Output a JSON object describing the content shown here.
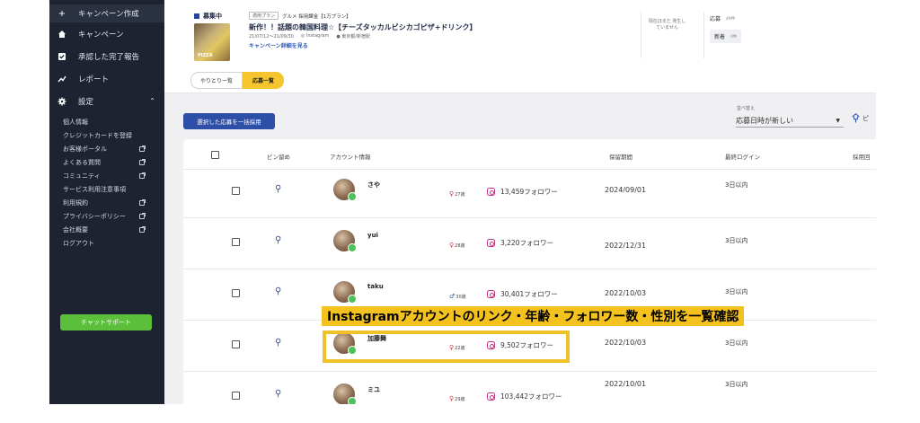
{
  "sidebar": {
    "create_campaign": "キャンペーン作成",
    "items": [
      {
        "label": "キャンペーン",
        "icon": "home-icon"
      },
      {
        "label": "承認した完了報告",
        "icon": "checkbox-icon"
      },
      {
        "label": "レポート",
        "icon": "chart-icon"
      },
      {
        "label": "設定",
        "icon": "gear-icon"
      }
    ],
    "settings_sub": [
      {
        "label": "個人情報",
        "external": false
      },
      {
        "label": "クレジットカードを登録",
        "external": false
      },
      {
        "label": "お客様ポータル",
        "external": true
      },
      {
        "label": "よくある質問",
        "external": true
      },
      {
        "label": "コミュニティ",
        "external": true
      },
      {
        "label": "サービス利用注意事項",
        "external": false
      },
      {
        "label": "利用規約",
        "external": true
      },
      {
        "label": "プライバシーポリシー",
        "external": true
      },
      {
        "label": "会社概要",
        "external": true
      },
      {
        "label": "ログアウト",
        "external": false
      }
    ],
    "chat_support": "チャットサポート"
  },
  "campaign": {
    "status": "募集中",
    "plan_tag": "適用プラン",
    "plan": "グルメ 採用課金【1万プラン】",
    "title": "新作！！話題の韓国料理☆【チーズタッカルビシカゴピザ+ドリンク】",
    "dates": "21/07/12〜21/09/30",
    "platform": "Instagram",
    "location": "東京都/新宿駅",
    "detail_link": "キャンペーン詳細を見る",
    "thumb_text": "PIZZA",
    "note": "現在ほまだ 発生していません",
    "apply_label": "応募",
    "apply_count": "49件",
    "new_label": "新着",
    "new_count": "0件"
  },
  "tabs": {
    "messages": "やりとり一覧",
    "applications": "応募一覧"
  },
  "controls": {
    "bulk_hire": "選択した応募を一括採用",
    "sort_label": "並べ替え",
    "sort_value": "応募日時が新しい",
    "pin_label": "ピ"
  },
  "table": {
    "headers": {
      "pin": "ピン留め",
      "account": "アカウント情報",
      "period": "保留期間",
      "last_login": "最終ログイン",
      "hire": "採用回"
    },
    "rows": [
      {
        "name": "さや",
        "sex": "female",
        "sex_symbol": "♀",
        "age": "27歳",
        "followers": "13,459フォロワー",
        "period": "2024/09/01",
        "login": "3日以内"
      },
      {
        "name": "yui",
        "sex": "female",
        "sex_symbol": "♀",
        "age": "28歳",
        "followers": "3,220フォロワー",
        "period": "2022/12/31",
        "login": "3日以内"
      },
      {
        "name": "taku",
        "sex": "male",
        "sex_symbol": "♂",
        "age": "30歳",
        "followers": "30,401フォロワー",
        "period": "2022/10/03",
        "login": "3日以内"
      },
      {
        "name": "加藤舞",
        "sex": "female",
        "sex_symbol": "♀",
        "age": "22歳",
        "followers": "9,502フォロワー",
        "period": "2022/10/03",
        "login": "3日以内"
      },
      {
        "name": "ミユ",
        "sex": "female",
        "sex_symbol": "♀",
        "age": "29歳",
        "followers": "103,442フォロワー",
        "period": "2022/10/01",
        "login": "3日以内"
      }
    ]
  },
  "annotation": {
    "text": "Instagramアカウントのリンク・年齢・フォロワー数・性別を一覧確認"
  },
  "colors": {
    "sidebar_bg": "#1d2330",
    "accent_blue": "#2d4fa8",
    "highlight_yellow": "#f4c21f",
    "chat_green": "#5bbf3c",
    "female": "#d8343e",
    "male": "#2d4fa8"
  }
}
